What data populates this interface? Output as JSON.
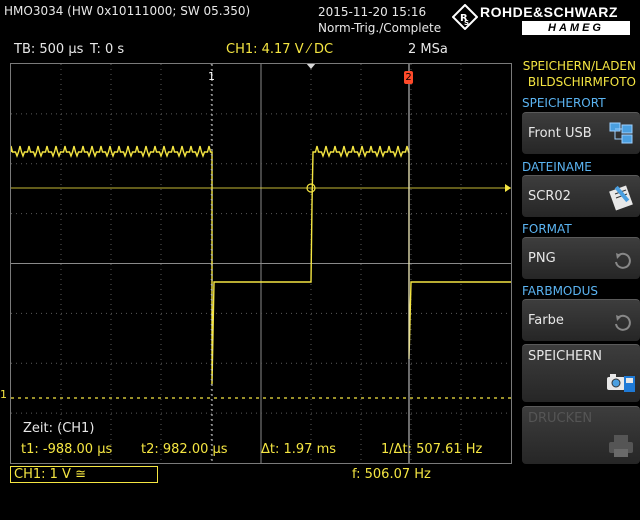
{
  "header": {
    "model": "HMO3034 (HW 0x10111000; SW 05.350)",
    "datetime": "2015-11-20 15:16",
    "trigger_status": "Norm-Trig./Complete",
    "brand": "ROHDE&SCHWARZ",
    "brand_sub": "HAMEG"
  },
  "status": {
    "timebase": "TB: 500 µs",
    "trigger_time": "T: 0 s",
    "channel_info": "CH1: 4.17 V ⁄ DC",
    "sample_rate": "2 MSa"
  },
  "screen": {
    "cursor1_label": "1",
    "cursor2_label": "2",
    "ground_marker": "1",
    "zeit_label": "Zeit: (CH1)",
    "measurements": {
      "t1": "t1: -988.00 µs",
      "t2": "t2: 982.00 µs",
      "dt": "Δt: 1.97 ms",
      "inv_dt": "1/Δt: 507.61 Hz"
    }
  },
  "bottom": {
    "ch1_badge": "CH1: 1 V ≅",
    "frequency": "f: 506.07 Hz"
  },
  "menu": {
    "title_line1": "SPEICHERN/LADEN",
    "title_line2": "BILDSCHIRMFOTO",
    "storage_label": "SPEICHERORT",
    "storage_value": "Front USB",
    "filename_label": "DATEINAME",
    "filename_value": "SCR02",
    "format_label": "FORMAT",
    "format_value": "PNG",
    "colormode_label": "FARBMODUS",
    "colormode_value": "Farbe",
    "save_label": "SPEICHERN",
    "print_label": "DRUCKEN"
  },
  "colors": {
    "trace": "#f5e642",
    "accent_blue": "#5bb4f2",
    "grid": "#6a6a6a",
    "cursor2": "#ff4a2a"
  }
}
